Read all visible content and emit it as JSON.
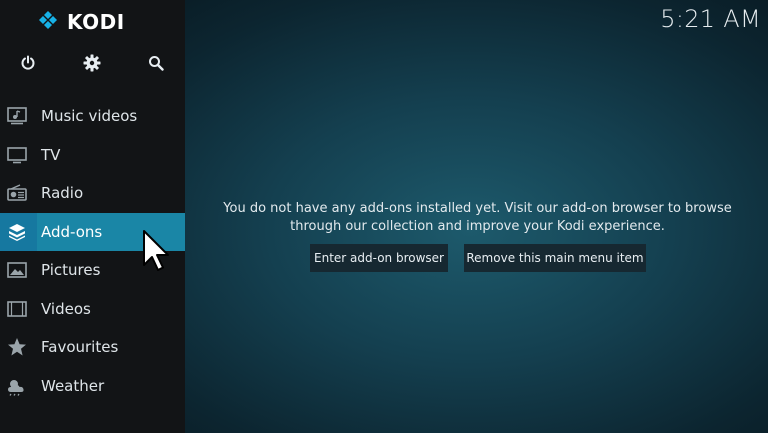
{
  "app": {
    "logo_text": "KODI"
  },
  "header": {
    "clock": "5:21 AM"
  },
  "toolbar": {
    "power_icon": "power-icon",
    "settings_icon": "gear-icon",
    "search_icon": "search-icon"
  },
  "sidebar": {
    "items": [
      {
        "label": "Music videos",
        "icon": "music-video-icon",
        "active": false
      },
      {
        "label": "TV",
        "icon": "tv-icon",
        "active": false
      },
      {
        "label": "Radio",
        "icon": "radio-icon",
        "active": false
      },
      {
        "label": "Add-ons",
        "icon": "addons-box-icon",
        "active": true
      },
      {
        "label": "Pictures",
        "icon": "pictures-icon",
        "active": false
      },
      {
        "label": "Videos",
        "icon": "videos-icon",
        "active": false
      },
      {
        "label": "Favourites",
        "icon": "star-icon",
        "active": false
      },
      {
        "label": "Weather",
        "icon": "weather-icon",
        "active": false
      }
    ]
  },
  "main": {
    "message": "You do not have any add-ons installed yet. Visit our add-on browser to browse through our collection and improve your Kodi experience.",
    "enter_browser_label": "Enter add-on browser",
    "remove_item_label": "Remove this main menu item"
  },
  "colors": {
    "accent": "#1a86a6",
    "sidebar_bg": "#121416",
    "logo_blue": "#17b2e7"
  }
}
